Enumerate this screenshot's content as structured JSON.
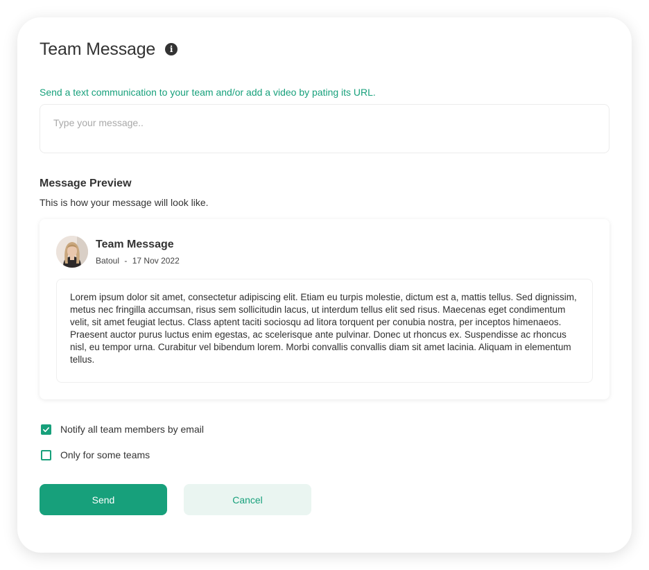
{
  "header": {
    "title": "Team Message",
    "info_glyph": "i",
    "info_icon": "info-circle-icon"
  },
  "composer": {
    "instructions": "Send a text communication to your team and/or add a video by pating its URL.",
    "value": "",
    "placeholder": "Type your message.."
  },
  "preview": {
    "heading": "Message Preview",
    "subheading": "This is how your message will look like.",
    "card": {
      "title": "Team Message",
      "author": "Batoul",
      "date": "17 Nov 2022",
      "separator": "-",
      "body": "Lorem ipsum dolor sit amet, consectetur adipiscing elit. Etiam eu turpis molestie, dictum est a, mattis tellus. Sed dignissim, metus nec fringilla accumsan, risus sem sollicitudin lacus, ut interdum tellus elit sed risus. Maecenas eget condimentum velit, sit amet feugiat lectus. Class aptent taciti sociosqu ad litora torquent per conubia nostra, per inceptos himenaeos. Praesent auctor purus luctus enim egestas, ac scelerisque ante pulvinar. Donec ut rhoncus ex. Suspendisse ac rhoncus nisl, eu tempor urna. Curabitur vel bibendum lorem. Morbi convallis convallis diam sit amet lacinia. Aliquam in elementum tellus."
    }
  },
  "options": [
    {
      "label": "Notify all team members by email",
      "checked": true
    },
    {
      "label": "Only for some teams",
      "checked": false
    }
  ],
  "actions": {
    "send_label": "Send",
    "cancel_label": "Cancel"
  },
  "colors": {
    "accent": "#17a07b",
    "cancel_bg": "#eaf5f1",
    "text": "#333333"
  }
}
